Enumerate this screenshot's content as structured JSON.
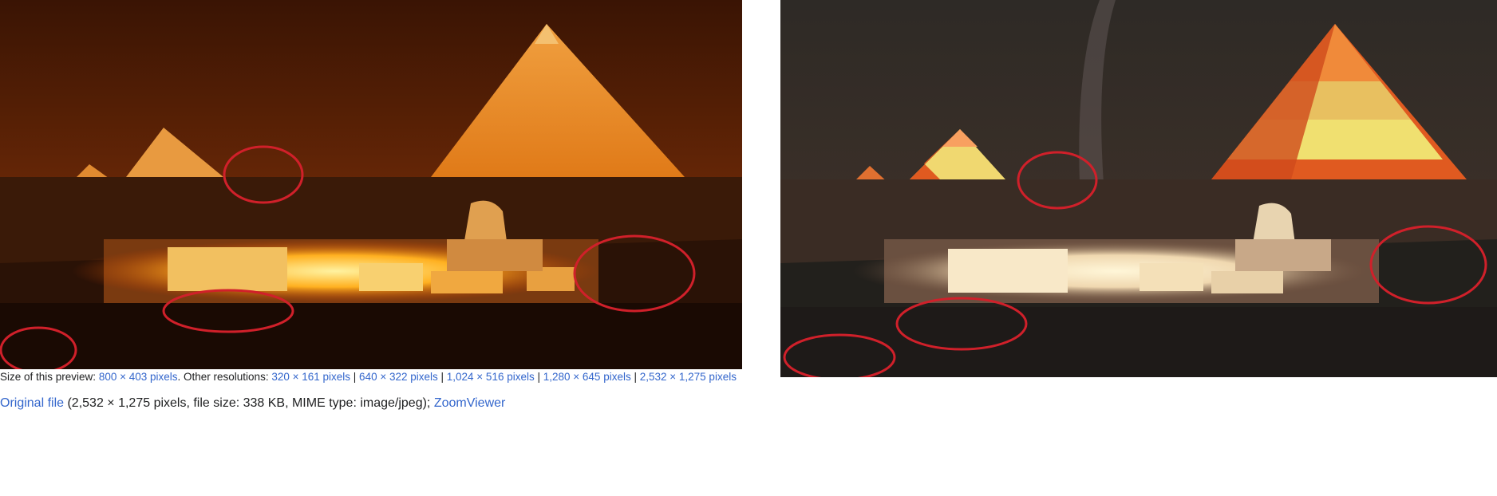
{
  "preview": {
    "prefix": "Size of this preview: ",
    "current_resolution": "800 × 403 pixels",
    "other_label": ". Other resolutions: ",
    "resolutions": [
      "320 × 161 pixels",
      "640 × 322 pixels",
      "1,024 × 516 pixels",
      "1,280 × 645 pixels",
      "2,532 × 1,275 pixels"
    ],
    "separator": " | "
  },
  "file_info": {
    "original_link": "Original file",
    "details": " (2,532 × 1,275 pixels, file size: 338 KB, MIME type: image/jpeg); ",
    "zoom_link": "ZoomViewer"
  },
  "images": {
    "left": {
      "subject": "Giza pyramids and Sphinx lit orange at night",
      "annotation_count": 4
    },
    "right": {
      "subject": "Giza pyramids and Sphinx lit with colored stripes at night",
      "annotation_count": 4
    }
  },
  "colors": {
    "annotation": "#d0202a",
    "link": "#3366cc",
    "text": "#202122"
  }
}
